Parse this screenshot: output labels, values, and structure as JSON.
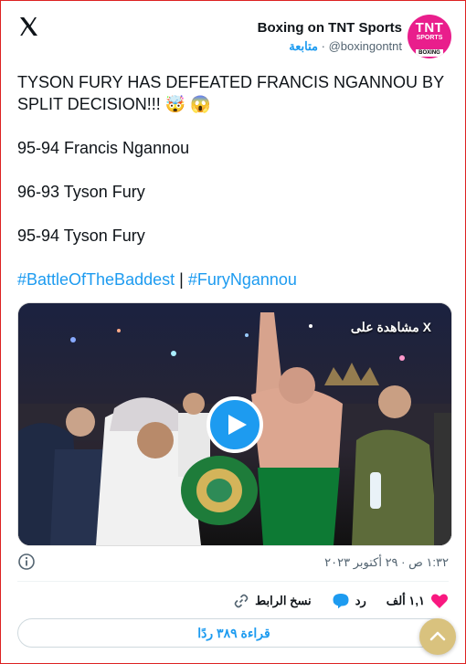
{
  "account": {
    "name": "Boxing on TNT Sports",
    "handle": "@boxingontnt",
    "follow_label": "متابعة",
    "separator": "·",
    "avatar": {
      "line1": "TNT",
      "line2": "SPORTS",
      "line3": "BOXING"
    }
  },
  "tweet": {
    "line1": "TYSON FURY HAS DEFEATED FRANCIS NGANNOU BY SPLIT DECISION!!! 🤯 😱",
    "score1": "95-94 Francis Ngannou",
    "score2": "96-93 Tyson Fury",
    "score3": "95-94 Tyson Fury",
    "hashtag1": "#BattleOfTheBaddest",
    "hashtag_separator": "|",
    "hashtag2": "#FuryNgannou"
  },
  "media": {
    "watch_label": "مشاهدة على X"
  },
  "meta": {
    "timestamp": "١:٣٢ ص · ٢٩ أكتوبر ٢٠٢٣"
  },
  "actions": {
    "likes": "١,١ ألف",
    "reply_label": "رد",
    "copy_link_label": "نسخ الرابط"
  },
  "read_replies": "قراءة ٣٨٩ ردًا",
  "colors": {
    "accent": "#1d9bf0",
    "like": "#f91880",
    "avatar_bg": "#e91e8c",
    "border": "#dd2222"
  },
  "icons": [
    "x-logo-icon",
    "info-icon",
    "heart-icon",
    "reply-bubble-icon",
    "link-icon",
    "play-icon",
    "chevron-up-icon"
  ]
}
